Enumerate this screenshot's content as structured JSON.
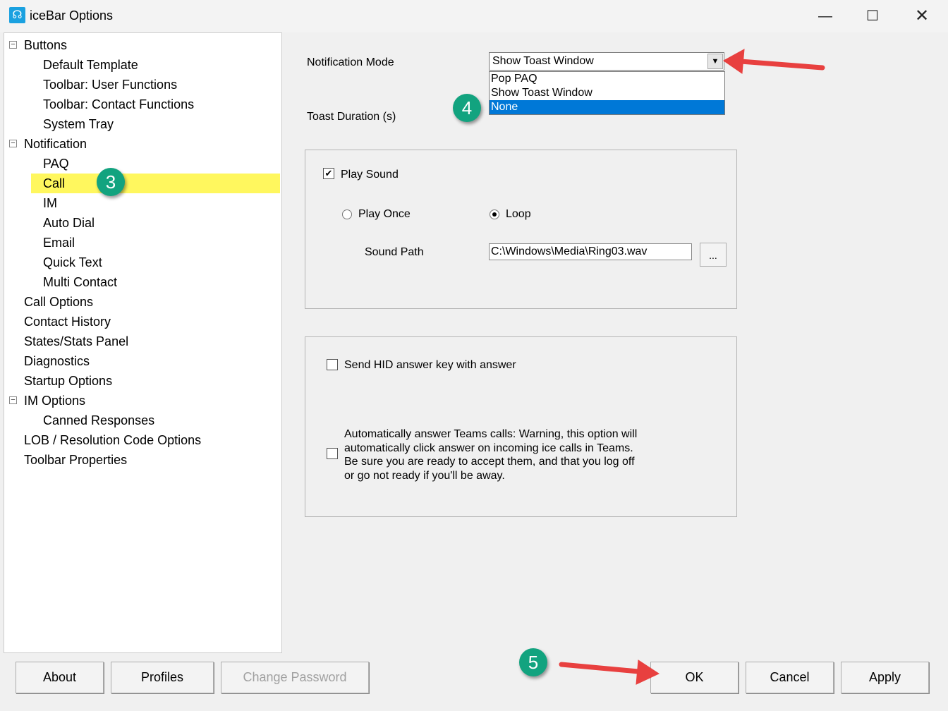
{
  "window": {
    "title": "iceBar Options",
    "icon": "headset-icon",
    "controls": [
      "minimize",
      "maximize",
      "close"
    ]
  },
  "tree": [
    {
      "label": "Buttons",
      "level": 0,
      "expanded": true
    },
    {
      "label": "Default Template",
      "level": 1
    },
    {
      "label": "Toolbar: User Functions",
      "level": 1
    },
    {
      "label": "Toolbar: Contact Functions",
      "level": 1
    },
    {
      "label": "System Tray",
      "level": 1
    },
    {
      "label": "Notification",
      "level": 0,
      "expanded": true
    },
    {
      "label": "PAQ",
      "level": 1
    },
    {
      "label": "Call",
      "level": 1,
      "selected": true
    },
    {
      "label": "IM",
      "level": 1
    },
    {
      "label": "Auto Dial",
      "level": 1
    },
    {
      "label": "Email",
      "level": 1
    },
    {
      "label": "Quick Text",
      "level": 1
    },
    {
      "label": "Multi Contact",
      "level": 1
    },
    {
      "label": "Call Options",
      "level": 0
    },
    {
      "label": "Contact History",
      "level": 0
    },
    {
      "label": "States/Stats Panel",
      "level": 0
    },
    {
      "label": "Diagnostics",
      "level": 0
    },
    {
      "label": "Startup Options",
      "level": 0
    },
    {
      "label": "IM Options",
      "level": 0,
      "expanded": true
    },
    {
      "label": "Canned Responses",
      "level": 1
    },
    {
      "label": "LOB / Resolution Code Options",
      "level": 0
    },
    {
      "label": "Toolbar Properties",
      "level": 0
    }
  ],
  "settings": {
    "notification_mode_label": "Notification Mode",
    "notification_mode_value": "Show Toast Window",
    "notification_mode_options": [
      "Pop PAQ",
      "Show Toast Window",
      "None"
    ],
    "notification_mode_highlighted": "None",
    "toast_duration_label": "Toast Duration (s)",
    "play_sound_label": "Play Sound",
    "play_sound_checked": true,
    "play_once_label": "Play Once",
    "loop_label": "Loop",
    "selected_playback": "Loop",
    "sound_path_label": "Sound Path",
    "sound_path_value": "C:\\Windows\\Media\\Ring03.wav",
    "browse_label": "...",
    "hid_label": "Send HID answer key with answer",
    "hid_checked": false,
    "auto_answer_label": "Automatically answer Teams calls: Warning, this option will automatically click answer on incoming ice calls in Teams.  Be sure you are ready to accept them, and that you log off or go not ready if you'll be away.",
    "auto_answer_checked": false
  },
  "buttons": {
    "about": "About",
    "profiles": "Profiles",
    "change_password": "Change Password",
    "ok": "OK",
    "cancel": "Cancel",
    "apply": "Apply"
  },
  "annotations": {
    "step3": "3",
    "step4": "4",
    "step5": "5",
    "arrow_color": "#e8403f",
    "badge_color": "#12a37f",
    "highlight_color": "#fff75e",
    "selection_color": "#0078d7"
  }
}
